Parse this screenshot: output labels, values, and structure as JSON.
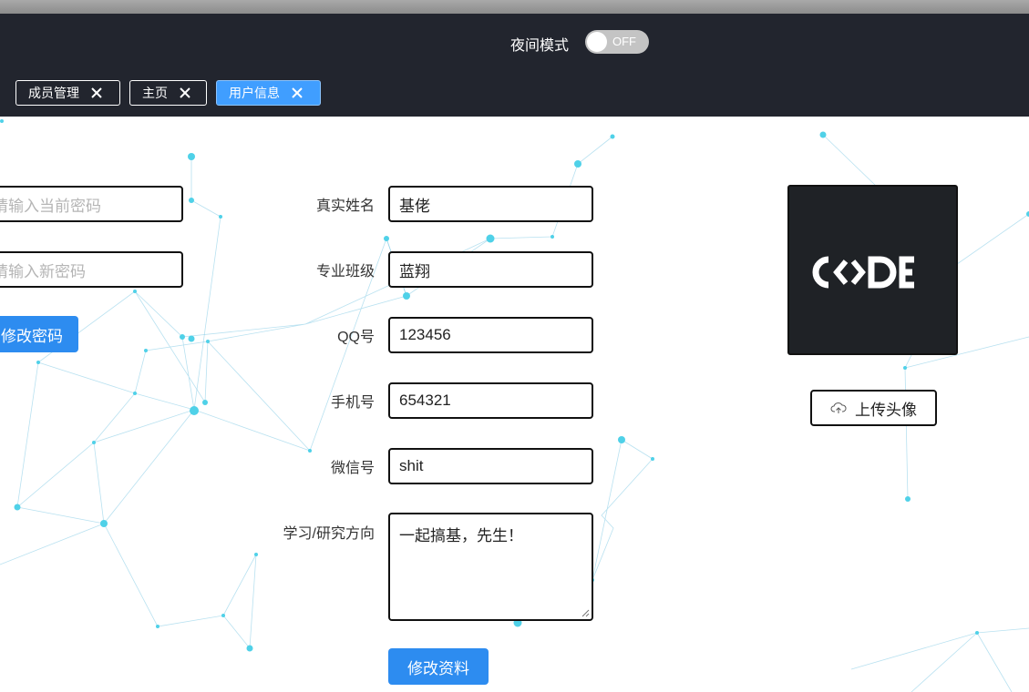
{
  "header": {
    "night_mode_label": "夜间模式",
    "night_mode_state": "OFF",
    "tabs": [
      {
        "label": "成员管理"
      },
      {
        "label": "主页"
      },
      {
        "label": "用户信息"
      }
    ]
  },
  "password": {
    "current_placeholder": "请输入当前密码",
    "new_placeholder": "请输入新密码",
    "submit_label": "修改密码"
  },
  "profile": {
    "fields": [
      {
        "label": "真实姓名",
        "value": "基佬"
      },
      {
        "label": "专业班级",
        "value": "蓝翔"
      },
      {
        "label": "QQ号",
        "value": "123456"
      },
      {
        "label": "手机号",
        "value": "654321"
      },
      {
        "label": "微信号",
        "value": "shit"
      },
      {
        "label": "学习/研究方向",
        "value": "一起搞基，先生！"
      }
    ],
    "submit_label": "修改资料"
  },
  "avatar": {
    "logo_text": "CODE",
    "upload_label": "上传头像"
  },
  "colors": {
    "header_bg": "#22252e",
    "accent": "#409eff",
    "primary_button": "#2d8cf0",
    "network": "#4fd1e8"
  }
}
